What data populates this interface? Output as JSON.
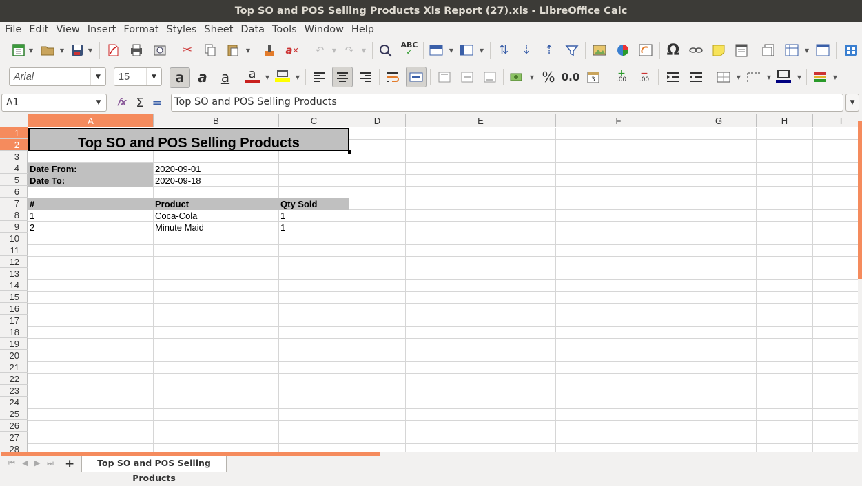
{
  "window": {
    "title": "Top SO and POS Selling Products Xls Report (27).xls - LibreOffice Calc"
  },
  "menu": [
    "File",
    "Edit",
    "View",
    "Insert",
    "Format",
    "Styles",
    "Sheet",
    "Data",
    "Tools",
    "Window",
    "Help"
  ],
  "format_toolbar": {
    "font_name": "Arial",
    "font_size": "15"
  },
  "formula_bar": {
    "cell_ref": "A1",
    "content": "Top SO and POS Selling Products"
  },
  "columns": [
    "A",
    "B",
    "C",
    "D",
    "E",
    "F",
    "G",
    "H",
    "I"
  ],
  "rows": [
    "1",
    "2",
    "3",
    "4",
    "5",
    "6",
    "7",
    "8",
    "9",
    "10",
    "11",
    "12",
    "13",
    "14",
    "15",
    "16",
    "17",
    "18",
    "19",
    "20",
    "21",
    "22",
    "23",
    "24",
    "25",
    "26",
    "27",
    "28"
  ],
  "sheet": {
    "title": "Top SO and POS Selling Products",
    "date_from_label": "Date From:",
    "date_from": "2020-09-01",
    "date_to_label": "Date To:",
    "date_to": "2020-09-18",
    "headers": [
      "#",
      "Product",
      "Qty Sold"
    ],
    "rows": [
      [
        "1",
        "Coca-Cola",
        "1"
      ],
      [
        "2",
        "Minute Maid",
        "1"
      ]
    ]
  },
  "tabs": {
    "active": "Top SO and POS Selling Products"
  },
  "accent_color": "#f58b5d"
}
